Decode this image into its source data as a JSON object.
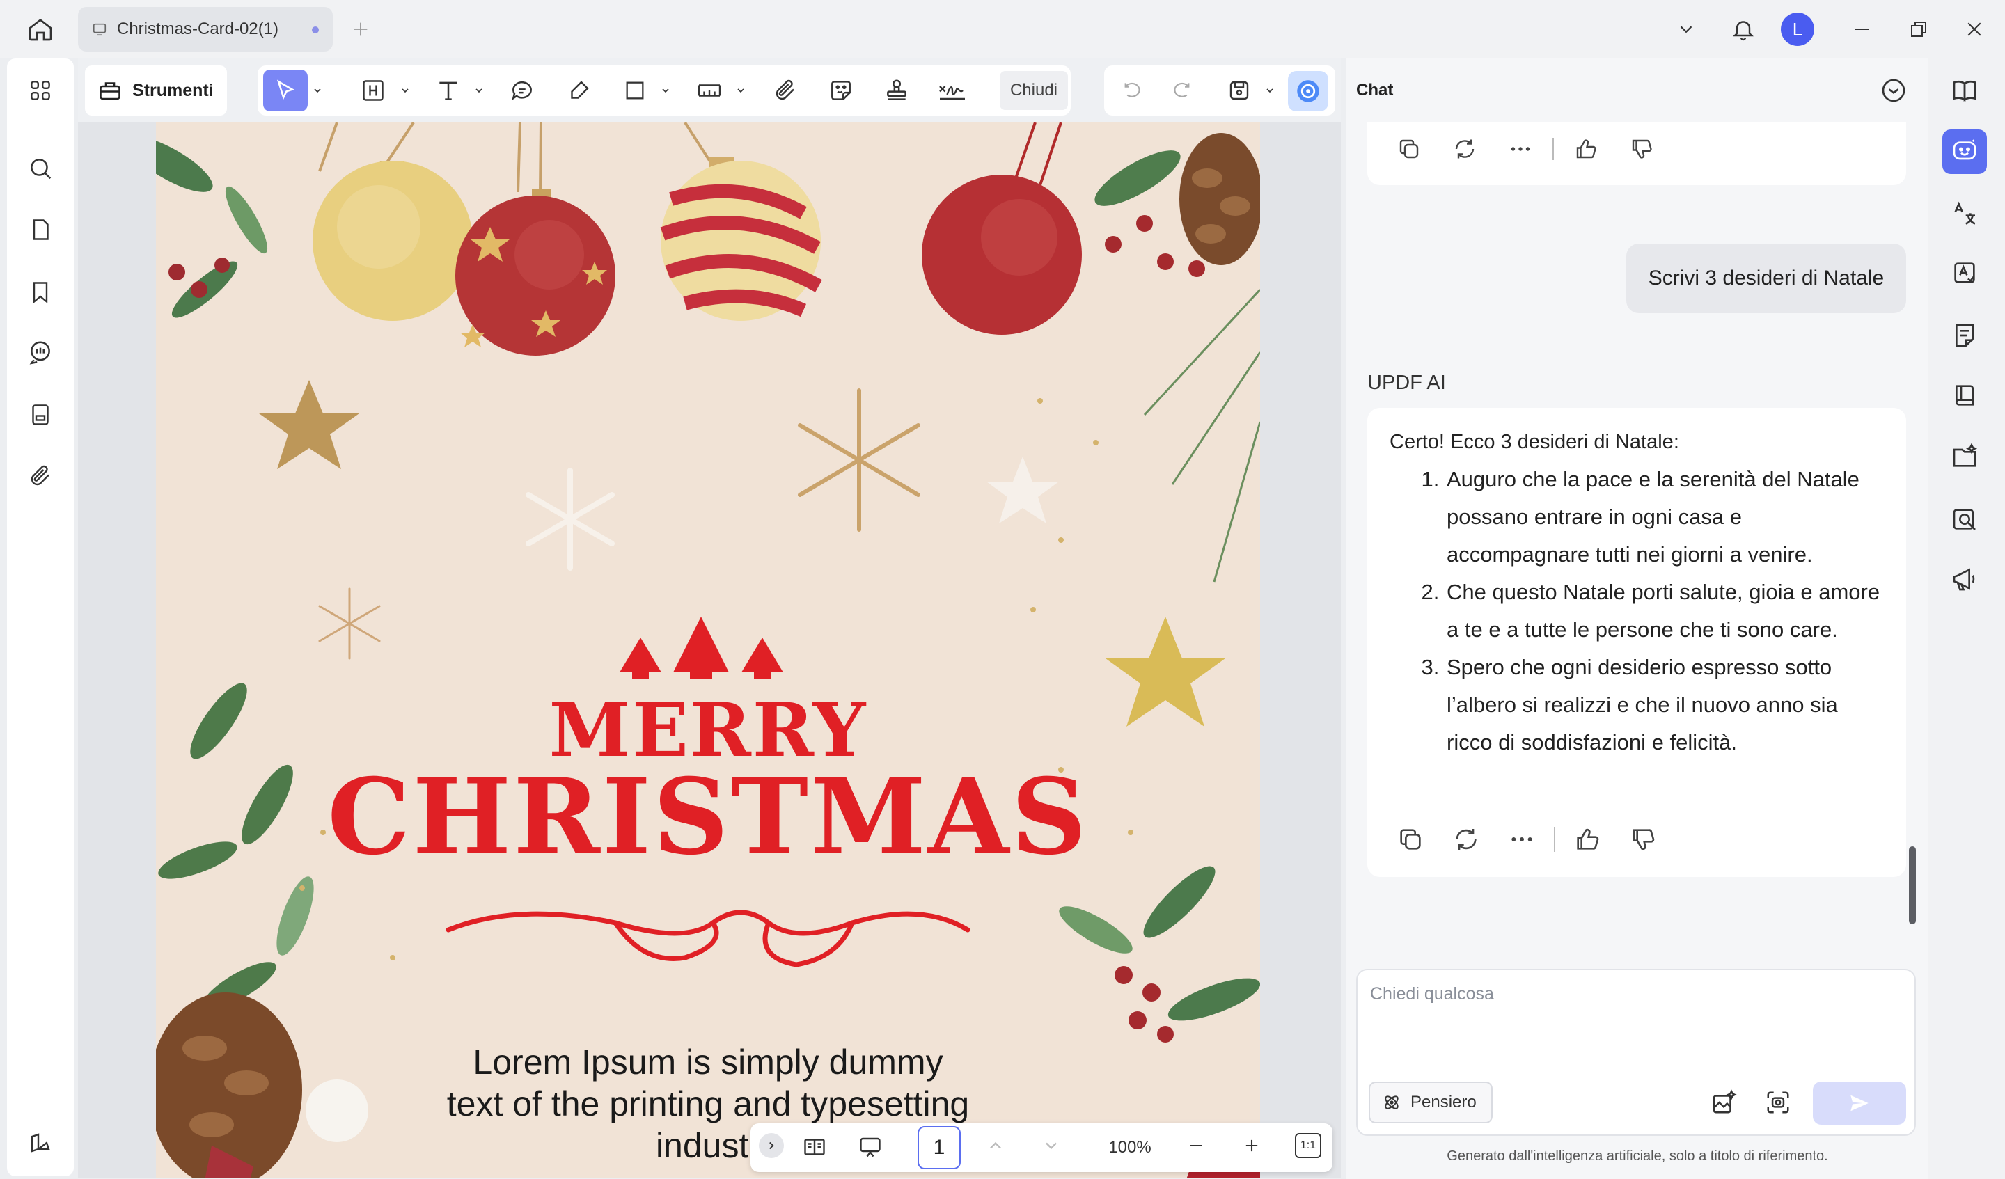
{
  "titlebar": {
    "tab_name": "Christmas-Card-02(1)",
    "avatar_letter": "L"
  },
  "toolbar": {
    "tools_label": "Strumenti",
    "close_label": "Chiudi"
  },
  "document": {
    "merry": "MERRY",
    "christmas": "CHRISTMAS",
    "lorem_line1": "Lorem Ipsum is simply dummy",
    "lorem_line2": "text of the printing and typesetting",
    "lorem_line3": "industr"
  },
  "bottombar": {
    "page_number": "1",
    "zoom": "100%",
    "fit_label": "1:1"
  },
  "chat": {
    "title": "Chat",
    "user_message": "Scrivi 3 desideri di Natale",
    "ai_label": "UPDF AI",
    "ai_intro": "Certo! Ecco 3 desideri di Natale:",
    "ai_items": [
      "Auguro che la pace e la serenità del Natale possano entrare in ogni casa e accompagnare tutti nei giorni a venire.",
      "Che questo Natale porti salute, gioia e amore a te e a tutte le persone che ti sono care.",
      "Spero che ogni desiderio espresso sotto l’albero si realizzi e che il nuovo anno sia ricco di soddisfazioni e felicità."
    ],
    "input_placeholder": "Chiedi qualcosa",
    "thinking_label": "Pensiero",
    "footer_note": "Generato dall'intelligenza artificiale, solo a titolo di riferimento."
  },
  "colors": {
    "accent": "#5b6ef0",
    "card_background": "#f1e3d6",
    "card_red": "#e02025"
  }
}
